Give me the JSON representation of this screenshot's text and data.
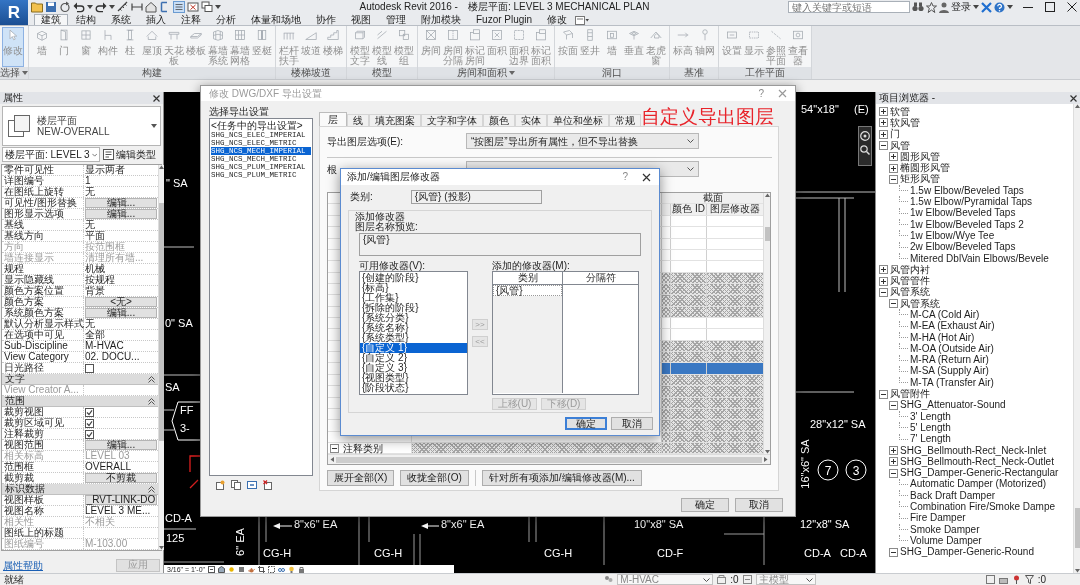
{
  "app": {
    "logo": "R"
  },
  "title_bar": {
    "app_title": "Autodesk Revit 2016 -",
    "view_title": "楼层平面: LEVEL 3 MECHANICAL PLAN",
    "search": {
      "placeholder": "键入关键字或短语"
    },
    "sign_in": "登录"
  },
  "ribbon": {
    "tabs": [
      {
        "label": "建筑",
        "selected": true
      },
      {
        "label": "结构",
        "selected": false
      },
      {
        "label": "系统",
        "selected": false
      },
      {
        "label": "插入",
        "selected": false
      },
      {
        "label": "注释",
        "selected": false
      },
      {
        "label": "分析",
        "selected": false
      },
      {
        "label": "体量和场地",
        "selected": false
      },
      {
        "label": "协作",
        "selected": false
      },
      {
        "label": "视图",
        "selected": false
      },
      {
        "label": "管理",
        "selected": false
      },
      {
        "label": "附加模块",
        "selected": false
      },
      {
        "label": "Fuzor Plugin",
        "selected": false
      },
      {
        "label": "修改",
        "selected": false
      }
    ],
    "disabled": true,
    "panels": [
      {
        "label": "选择",
        "menu": true,
        "tools": [
          {
            "label": "修改",
            "selected": true
          }
        ]
      },
      {
        "label": "构建",
        "menu": false,
        "tools": [
          {
            "label": "墙",
            "selected": false
          },
          {
            "label": "门",
            "selected": false
          },
          {
            "label": "窗",
            "selected": false
          },
          {
            "label": "构件",
            "selected": false
          },
          {
            "label": "柱",
            "selected": false
          },
          {
            "label": "屋顶",
            "selected": false
          },
          {
            "label": "天花板",
            "selected": false
          },
          {
            "label": "楼板",
            "selected": false
          },
          {
            "label": "幕墙系统",
            "selected": false
          },
          {
            "label": "幕墙网格",
            "selected": false
          },
          {
            "label": "竖梃",
            "selected": false
          }
        ]
      },
      {
        "label": "楼梯坡道",
        "menu": false,
        "tools": [
          {
            "label": "栏杆扶手",
            "selected": false
          },
          {
            "label": "坡道",
            "selected": false
          },
          {
            "label": "楼梯",
            "selected": false
          }
        ]
      },
      {
        "label": "模型",
        "menu": false,
        "tools": [
          {
            "label": "模型文字",
            "selected": false
          },
          {
            "label": "模型线",
            "selected": false
          },
          {
            "label": "模型组",
            "selected": false
          }
        ]
      },
      {
        "label": "房间和面积",
        "menu": true,
        "tools": [
          {
            "label": "房间",
            "selected": false
          },
          {
            "label": "房间分隔",
            "selected": false
          },
          {
            "label": "标记房间",
            "selected": false
          },
          {
            "label": "面积",
            "selected": false
          },
          {
            "label": "面积边界",
            "selected": false
          },
          {
            "label": "标记面积",
            "selected": false
          }
        ]
      },
      {
        "label": "洞口",
        "menu": false,
        "tools": [
          {
            "label": "按面",
            "selected": false
          },
          {
            "label": "竖井",
            "selected": false
          },
          {
            "label": "墙",
            "selected": false
          },
          {
            "label": "垂直",
            "selected": false
          },
          {
            "label": "老虎窗",
            "selected": false
          }
        ]
      },
      {
        "label": "基准",
        "menu": false,
        "tools": [
          {
            "label": "标高",
            "selected": false
          },
          {
            "label": "轴网",
            "selected": false
          }
        ]
      },
      {
        "label": "工作平面",
        "menu": false,
        "tools": [
          {
            "label": "设置",
            "selected": false
          },
          {
            "label": "显示",
            "selected": false
          },
          {
            "label": "参照平面",
            "selected": false
          },
          {
            "label": "查看器",
            "selected": false
          }
        ]
      }
    ]
  },
  "properties": {
    "title": "属性",
    "type_selector": {
      "family": "楼层平面",
      "type": "NEW-OVERALL"
    },
    "instance_filter": "楼层平面: LEVEL 3",
    "edit_type": "编辑类型",
    "rows": [
      {
        "kind": "text",
        "label": "零件可见性",
        "value": "显示两者",
        "disabled": false
      },
      {
        "kind": "text",
        "label": "详图编号",
        "value": "1",
        "disabled": false
      },
      {
        "kind": "text",
        "label": "在图纸上旋转",
        "value": "无",
        "disabled": false
      },
      {
        "kind": "button",
        "label": "可见性/图形替换",
        "value": "编辑...",
        "disabled": false
      },
      {
        "kind": "button",
        "label": "图形显示选项",
        "value": "编辑...",
        "disabled": false
      },
      {
        "kind": "text",
        "label": "基线",
        "value": "无",
        "disabled": false
      },
      {
        "kind": "text",
        "label": "基线方向",
        "value": "平面",
        "disabled": false
      },
      {
        "kind": "text",
        "label": "方向",
        "value": "按范围框",
        "disabled": true
      },
      {
        "kind": "text",
        "label": "墙连接显示",
        "value": "清理所有墙...",
        "disabled": true
      },
      {
        "kind": "text",
        "label": "规程",
        "value": "机械",
        "disabled": false
      },
      {
        "kind": "text",
        "label": "显示隐藏线",
        "value": "按规程",
        "disabled": false
      },
      {
        "kind": "text",
        "label": "颜色方案位置",
        "value": "背景",
        "disabled": false
      },
      {
        "kind": "button",
        "label": "颜色方案",
        "value": "<无>",
        "disabled": false
      },
      {
        "kind": "button",
        "label": "系统颜色方案",
        "value": "编辑...",
        "disabled": false
      },
      {
        "kind": "text",
        "label": "默认分析显示样式",
        "value": "无",
        "disabled": false
      },
      {
        "kind": "text",
        "label": "在选项中可见",
        "value": "全部",
        "disabled": false
      },
      {
        "kind": "text",
        "label": "Sub-Discipline",
        "value": "M-HVAC",
        "disabled": false
      },
      {
        "kind": "text",
        "label": "View Category",
        "value": "02. DOCU...",
        "disabled": false
      },
      {
        "kind": "checkbox",
        "label": "日光路径",
        "checked": false,
        "disabled": false
      },
      {
        "kind": "section",
        "label": "文字",
        "expanded": true
      },
      {
        "kind": "text",
        "label": "View Creator A...",
        "disabled": true
      },
      {
        "kind": "section",
        "label": "范围",
        "expanded": true
      },
      {
        "kind": "checkbox",
        "label": "裁剪视图",
        "checked": true,
        "disabled": false
      },
      {
        "kind": "checkbox",
        "label": "裁剪区域可见",
        "checked": true,
        "disabled": false
      },
      {
        "kind": "checkbox",
        "label": "注释裁剪",
        "checked": true,
        "disabled": false
      },
      {
        "kind": "button",
        "label": "视图范围",
        "value": "编辑...",
        "disabled": false
      },
      {
        "kind": "text",
        "label": "相关标高",
        "value": "LEVEL 03",
        "disabled": true
      },
      {
        "kind": "text",
        "label": "范围框",
        "value": "OVERALL",
        "disabled": false
      },
      {
        "kind": "button",
        "label": "截剪裁",
        "value": "不剪裁",
        "disabled": false
      },
      {
        "kind": "section",
        "label": "标识数据",
        "expanded": true
      },
      {
        "kind": "button",
        "label": "视图样板",
        "value": "_RVT-LINK-DO",
        "disabled": false
      },
      {
        "kind": "text",
        "label": "视图名称",
        "value": "LEVEL 3 ME...",
        "disabled": false
      },
      {
        "kind": "text",
        "label": "相关性",
        "value": "不相关",
        "disabled": true
      },
      {
        "kind": "text",
        "label": "图纸上的标题",
        "disabled": false
      },
      {
        "kind": "text",
        "label": "图纸编号",
        "value": "M-103.00",
        "disabled": true
      }
    ],
    "help_link": "属性帮助",
    "apply": {
      "label": "应用",
      "disabled": true
    }
  },
  "drawing": {
    "labels": [
      {
        "kind": "text",
        "text": "\" SA"
      },
      {
        "kind": "text",
        "text": "0\" SA"
      },
      {
        "kind": "text",
        "text": "SA"
      },
      {
        "kind": "tag",
        "text": "FF"
      },
      {
        "kind": "tag",
        "text": "3-"
      },
      {
        "kind": "text",
        "text": "CD-A"
      },
      {
        "kind": "text",
        "text": "125"
      },
      {
        "kind": "vertical",
        "text": "6\" EA"
      },
      {
        "kind": "text",
        "text": "8\"x6\" EA"
      },
      {
        "kind": "text",
        "text": "8\"x6\" EA"
      },
      {
        "kind": "text",
        "text": "10\"x8\" SA"
      },
      {
        "kind": "text",
        "text": "CG-H"
      },
      {
        "kind": "text",
        "text": "CG-H"
      },
      {
        "kind": "text",
        "text": "CG-H"
      },
      {
        "kind": "text",
        "text": "CD-F"
      },
      {
        "kind": "text",
        "text": "54\"x18\""
      },
      {
        "kind": "text",
        "text": "(E)"
      },
      {
        "kind": "text",
        "text": "28\"x12\" SA"
      },
      {
        "kind": "vertical",
        "text": "16\"x6\" SA"
      },
      {
        "kind": "circle",
        "text": "7"
      },
      {
        "kind": "circle",
        "text": "3"
      },
      {
        "kind": "text",
        "text": "12\"x8\" SA"
      },
      {
        "kind": "text",
        "text": "CD-A"
      },
      {
        "kind": "text",
        "text": "CD-A"
      }
    ],
    "scale": "3/16\" = 1'-0\""
  },
  "project_browser": {
    "title": "项目浏览器 -",
    "tree": [
      {
        "label": "软管",
        "expanded": false
      },
      {
        "label": "软风管",
        "expanded": false
      },
      {
        "label": "门",
        "expanded": false
      },
      {
        "label": "风管",
        "expanded": true,
        "children": [
          {
            "label": "圆形风管",
            "expanded": false
          },
          {
            "label": "椭圆形风管",
            "expanded": false
          },
          {
            "label": "矩形风管",
            "expanded": true,
            "children": [
              {
                "label": "1.5w Elbow/Beveled Taps"
              },
              {
                "label": "1.5w Elbow/Pyramidal Taps"
              },
              {
                "label": "1w Elbow/Beveled Taps"
              },
              {
                "label": "1w Elbow/Beveled Taps 2"
              },
              {
                "label": "1w Elbow/Wye Tee"
              },
              {
                "label": "2w Elbow/Beveled Taps"
              },
              {
                "label": "Mitered DblVain Elbows/Bevele"
              }
            ]
          }
        ]
      },
      {
        "label": "风管内衬",
        "expanded": false
      },
      {
        "label": "风管管件",
        "expanded": false
      },
      {
        "label": "风管系统",
        "expanded": true,
        "children": [
          {
            "label": "风管系统",
            "expanded": true,
            "children": [
              {
                "label": "M-CA (Cold Air)"
              },
              {
                "label": "M-EA (Exhaust Air)"
              },
              {
                "label": "M-HA (Hot Air)"
              },
              {
                "label": "M-OA (Outside Air)"
              },
              {
                "label": "M-RA (Return Air)"
              },
              {
                "label": "M-SA (Supply Air)"
              },
              {
                "label": "M-TA (Transfer Air)"
              }
            ]
          }
        ]
      },
      {
        "label": "风管附件",
        "expanded": true,
        "children": [
          {
            "label": "SHG_Attenuator-Sound",
            "expanded": true,
            "children": [
              {
                "label": "3' Length"
              },
              {
                "label": "5' Length"
              },
              {
                "label": "7' Length"
              }
            ]
          },
          {
            "label": "SHG_Bellmouth-Rect_Neck-Inlet",
            "expanded": false
          },
          {
            "label": "SHG_Bellmouth-Rect_Neck-Outlet",
            "expanded": false
          },
          {
            "label": "SHG_Damper-Generic-Rectangular",
            "expanded": true,
            "children": [
              {
                "label": "Automatic Damper (Motorized)"
              },
              {
                "label": "Back Draft Damper"
              },
              {
                "label": "Combination Fire/Smoke Dampe"
              },
              {
                "label": "Fire Damper"
              },
              {
                "label": "Smoke Damper"
              },
              {
                "label": "Volume Damper"
              }
            ]
          },
          {
            "label": "SHG_Damper-Generic-Round",
            "expanded": true
          }
        ]
      }
    ]
  },
  "export_dialog": {
    "title": "修改 DWG/DXF 导出设置",
    "active": false,
    "help": "?",
    "setups_label": "选择导出设置",
    "session_setup": {
      "label": "<任务中的导出设置>",
      "selected": false
    },
    "setups": [
      {
        "label": "SHG_NCS_ELEC_IMPERIAL",
        "selected": false
      },
      {
        "label": "SHG_NCS_ELEC_METRIC",
        "selected": false
      },
      {
        "label": "SHG_NCS_MECH_IMPERIAL",
        "selected": true
      },
      {
        "label": "SHG_NCS_MECH_METRIC",
        "selected": false
      },
      {
        "label": "SHG_NCS_PLUM_IMPERIAL",
        "selected": false
      },
      {
        "label": "SHG_NCS_PLUM_METRIC",
        "selected": false
      }
    ],
    "tabs": [
      {
        "label": "层",
        "selected": true
      },
      {
        "label": "线",
        "selected": false
      },
      {
        "label": "填充图案",
        "selected": false
      },
      {
        "label": "文字和字体",
        "selected": false
      },
      {
        "label": "颜色",
        "selected": false
      },
      {
        "label": "实体",
        "selected": false
      },
      {
        "label": "单位和坐标",
        "selected": false
      },
      {
        "label": "常规",
        "selected": false
      }
    ],
    "annotation": "自定义导出图层",
    "layer_options": {
      "label": "导出图层选项(E):",
      "value": "“按图层”导出所有属性，但不导出替换"
    },
    "standard_label": "根",
    "layer_table": {
      "group_header": "截面",
      "columns": [
        "颜色 ID",
        "图层修改器"
      ],
      "rows": [
        {
          "hatched": false,
          "selected": false
        },
        {
          "hatched": false,
          "selected": false
        },
        {
          "hatched": false,
          "selected": false
        },
        {
          "hatched": false,
          "selected": false
        },
        {
          "hatched": false,
          "selected": false
        },
        {
          "hatched": true,
          "selected": false
        },
        {
          "hatched": true,
          "selected": false
        },
        {
          "hatched": true,
          "selected": false
        },
        {
          "hatched": true,
          "selected": false
        },
        {
          "hatched": false,
          "selected": false
        },
        {
          "hatched": false,
          "selected": false
        },
        {
          "hatched": true,
          "selected": false
        },
        {
          "hatched": true,
          "selected": false
        },
        {
          "hatched": false,
          "selected": true
        },
        {
          "hatched": true,
          "selected": false
        },
        {
          "hatched": true,
          "selected": false
        },
        {
          "hatched": true,
          "selected": false
        },
        {
          "hatched": true,
          "selected": false
        },
        {
          "hatched": true,
          "selected": false
        },
        {
          "hatched": true,
          "selected": false
        }
      ],
      "last_row": {
        "label": "注释类别",
        "expanded": true
      }
    },
    "buttons": [
      "展开全部(X)",
      "收拢全部(O)",
      "针对所有项添加/编辑修改器(M)..."
    ],
    "ok": "确定",
    "cancel": "取消"
  },
  "modifier_dialog": {
    "title": "添加/编辑图层修改器",
    "help": "?",
    "category_label": "类别:",
    "category": "{风管} (投影)",
    "group_label": "添加修改器",
    "preview_label": "图层名称预览:",
    "preview": "{风管}",
    "available_label": "可用修改器(V):",
    "available": [
      {
        "label": "{创建的阶段}",
        "selected": false
      },
      {
        "label": "{标高}",
        "selected": false
      },
      {
        "label": "{工作集}",
        "selected": false
      },
      {
        "label": "{拆除的阶段}",
        "selected": false
      },
      {
        "label": "{系统分类}",
        "selected": false
      },
      {
        "label": "{系统名称}",
        "selected": false
      },
      {
        "label": "{系统类型}",
        "selected": false
      },
      {
        "label": "{自定义 1}",
        "selected": true
      },
      {
        "label": "{自定义 2}",
        "selected": false
      },
      {
        "label": "{自定义 3}",
        "selected": false
      },
      {
        "label": "{视图类型}",
        "selected": false
      },
      {
        "label": "{阶段状态}",
        "selected": false
      }
    ],
    "add": ">>",
    "remove": "<<",
    "added_label": "添加的修改器(M):",
    "added_columns": [
      "类别",
      "分隔符"
    ],
    "added": [
      {
        "modifier": "{风管}"
      }
    ],
    "move_up": {
      "label": "上移(U)",
      "disabled": true
    },
    "move_down": {
      "label": "下移(D)",
      "disabled": true
    },
    "ok": {
      "label": "确定",
      "default": true
    },
    "cancel": "取消"
  },
  "status_bar": {
    "message": "就绪",
    "workset": "M-HVAC",
    "workset_count": ":0",
    "design_option": "主模型",
    "selection_count": ":0"
  }
}
